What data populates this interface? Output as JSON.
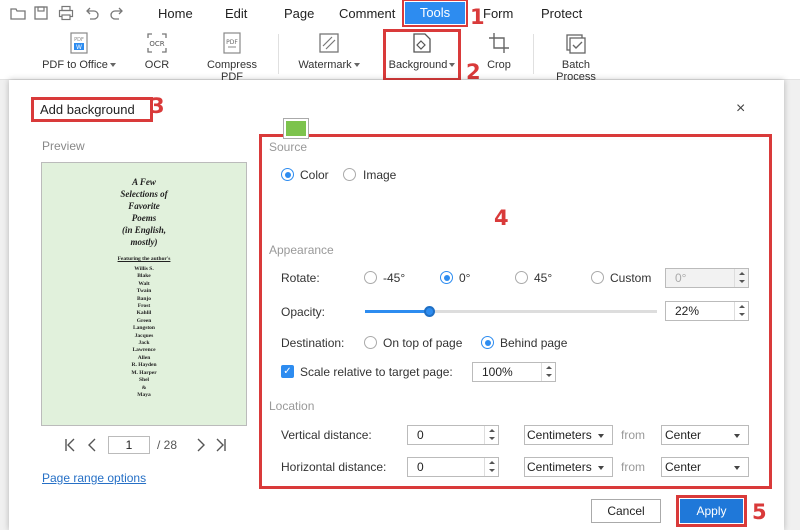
{
  "menu": {
    "items": [
      "Home",
      "Edit",
      "Page",
      "Comment",
      "Tools",
      "Form",
      "Protect"
    ],
    "active": "Tools"
  },
  "toolbar": {
    "tools": [
      {
        "label": "PDF to Office",
        "icon": "pdf-to-word-icon",
        "dropdown": true
      },
      {
        "label": "OCR",
        "icon": "ocr-icon",
        "dropdown": false
      },
      {
        "label": "Compress PDF",
        "icon": "compress-pdf-icon",
        "dropdown": false
      },
      {
        "label": "Watermark",
        "icon": "watermark-icon",
        "dropdown": true
      },
      {
        "label": "Background",
        "icon": "background-icon",
        "dropdown": true
      },
      {
        "label": "Crop",
        "icon": "crop-icon",
        "dropdown": false
      },
      {
        "label": "Batch Process",
        "icon": "batch-process-icon",
        "dropdown": false
      }
    ]
  },
  "steps": [
    "1",
    "2",
    "3",
    "4",
    "5"
  ],
  "dialog": {
    "title": "Add background",
    "close": "×",
    "preview_label": "Preview",
    "preview_page": {
      "title_lines": [
        "A Few",
        "Selections of",
        "Favorite",
        "Poems",
        "(in English,",
        "mostly)"
      ],
      "subtitle": "Featuring the author's",
      "names": [
        "Willis S.",
        "Blake",
        "Walt",
        "Twain",
        "Banjo",
        "Frost",
        "Kahlil",
        "Green",
        "Langston",
        "Jacques",
        "Jack",
        "Lawrence",
        "Allen",
        "R. Hayden",
        "M. Harper",
        "Shel",
        "&",
        "Maya"
      ]
    },
    "pager": {
      "current": "1",
      "total": "/ 28"
    },
    "page_range_link": "Page range options",
    "source": {
      "heading": "Source",
      "options": [
        "Color",
        "Image"
      ],
      "selected": "Color",
      "swatch_color": "#7dc34d"
    },
    "appearance": {
      "heading": "Appearance",
      "rotate_label": "Rotate:",
      "rotate_options": [
        "-45°",
        "0°",
        "45°",
        "Custom"
      ],
      "rotate_selected": "0°",
      "custom_value": "0°",
      "opacity_label": "Opacity:",
      "opacity_value": "22%",
      "opacity_fraction": 0.22,
      "destination_label": "Destination:",
      "destination_options": [
        "On top of page",
        "Behind page"
      ],
      "destination_selected": "Behind page",
      "scale_label": "Scale relative to target page:",
      "scale_checked": true,
      "scale_value": "100%"
    },
    "location": {
      "heading": "Location",
      "vertical_label": "Vertical distance:",
      "vertical_value": "0",
      "vertical_unit": "Centimeters",
      "vertical_from": "Center",
      "horizontal_label": "Horizontal distance:",
      "horizontal_value": "0",
      "horizontal_unit": "Centimeters",
      "horizontal_from": "Center",
      "from_label": "from"
    },
    "cancel_label": "Cancel",
    "apply_label": "Apply"
  },
  "colors": {
    "accent": "#2d8cf0",
    "annotation": "#d93a3a",
    "preview_bg": "#e1f1dc"
  }
}
